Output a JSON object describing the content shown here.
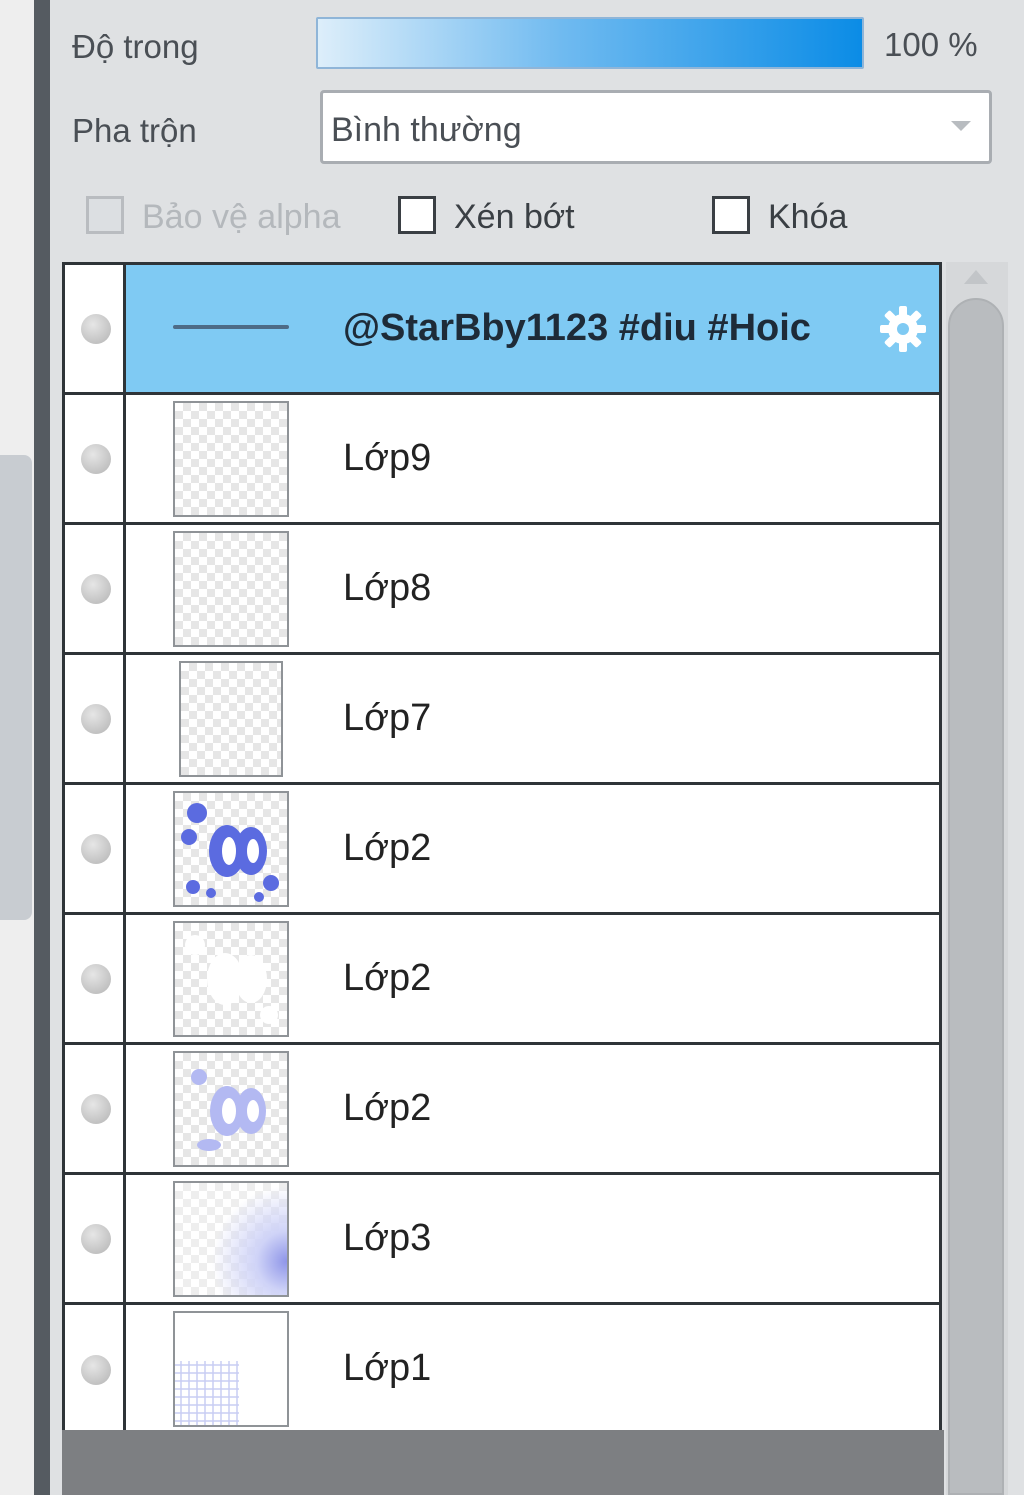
{
  "properties": {
    "opacity_label": "Độ trong",
    "opacity_value": "100 %",
    "opacity_fraction": 1.0,
    "blend_label": "Pha trộn",
    "blend_value": "Bình thường"
  },
  "checkboxes": {
    "protect_alpha": {
      "label": "Bảo vệ alpha",
      "checked": false,
      "enabled": false
    },
    "clip": {
      "label": "Xén bớt",
      "checked": false,
      "enabled": true
    },
    "lock": {
      "label": "Khóa",
      "checked": false,
      "enabled": true
    }
  },
  "layers": [
    {
      "name": "@StarBby1123 #diu #Hoic",
      "selected": true,
      "thumb": "line"
    },
    {
      "name": "Lớp9",
      "selected": false,
      "thumb": "empty"
    },
    {
      "name": "Lớp8",
      "selected": false,
      "thumb": "empty"
    },
    {
      "name": "Lớp7",
      "selected": false,
      "thumb": "empty"
    },
    {
      "name": "Lớp2",
      "selected": false,
      "thumb": "blue-shapes"
    },
    {
      "name": "Lớp2",
      "selected": false,
      "thumb": "white-shapes"
    },
    {
      "name": "Lớp2",
      "selected": false,
      "thumb": "faint-shapes"
    },
    {
      "name": "Lớp3",
      "selected": false,
      "thumb": "gradient"
    },
    {
      "name": "Lớp1",
      "selected": false,
      "thumb": "grid"
    }
  ],
  "colors": {
    "selected_row": "#7fcaf3",
    "opacity_bar": "#0b8ce6"
  }
}
